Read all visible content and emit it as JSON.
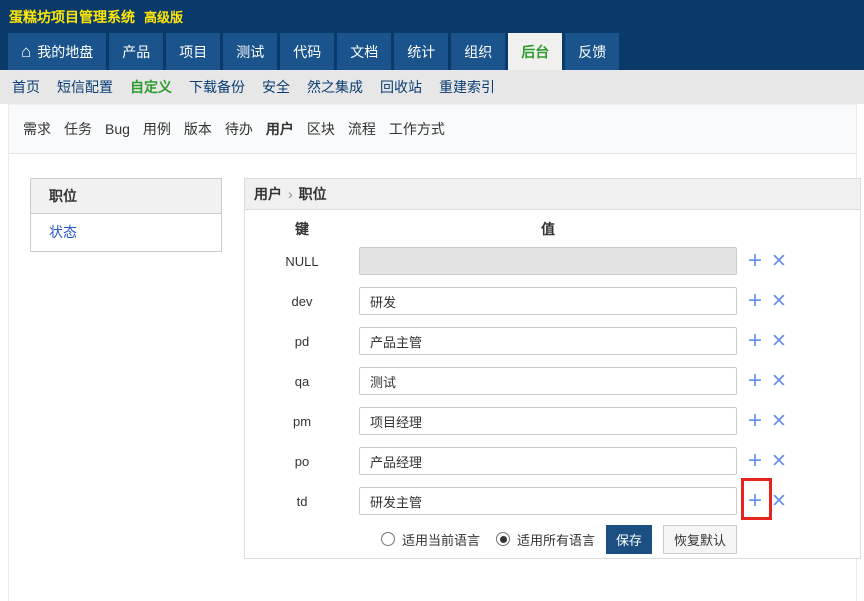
{
  "header": {
    "title": "蛋糕坊项目管理系统",
    "edition": "高级版"
  },
  "main_nav": {
    "items": [
      {
        "label": "我的地盘",
        "icon": "home",
        "active": false
      },
      {
        "label": "产品",
        "active": false
      },
      {
        "label": "项目",
        "active": false
      },
      {
        "label": "测试",
        "active": false
      },
      {
        "label": "代码",
        "active": false
      },
      {
        "label": "文档",
        "active": false
      },
      {
        "label": "统计",
        "active": false
      },
      {
        "label": "组织",
        "active": false
      },
      {
        "label": "后台",
        "active": true
      },
      {
        "label": "反馈",
        "active": false
      }
    ]
  },
  "sub_nav": {
    "items": [
      {
        "label": "首页",
        "active": false
      },
      {
        "label": "短信配置",
        "active": false
      },
      {
        "label": "自定义",
        "active": true
      },
      {
        "label": "下载备份",
        "active": false
      },
      {
        "label": "安全",
        "active": false
      },
      {
        "label": "然之集成",
        "active": false
      },
      {
        "label": "回收站",
        "active": false
      },
      {
        "label": "重建索引",
        "active": false
      }
    ]
  },
  "module_nav": {
    "items": [
      {
        "label": "需求",
        "active": false
      },
      {
        "label": "任务",
        "active": false
      },
      {
        "label": "Bug",
        "active": false
      },
      {
        "label": "用例",
        "active": false
      },
      {
        "label": "版本",
        "active": false
      },
      {
        "label": "待办",
        "active": false
      },
      {
        "label": "用户",
        "active": true
      },
      {
        "label": "区块",
        "active": false
      },
      {
        "label": "流程",
        "active": false
      },
      {
        "label": "工作方式",
        "active": false
      }
    ]
  },
  "sidebar": {
    "header": "职位",
    "items": [
      {
        "label": "状态"
      }
    ]
  },
  "panel": {
    "breadcrumb": {
      "parent": "用户",
      "separator": "›",
      "current": "职位"
    },
    "table": {
      "key_header": "键",
      "value_header": "值",
      "rows": [
        {
          "key": "NULL",
          "value": "",
          "disabled": true
        },
        {
          "key": "dev",
          "value": "研发"
        },
        {
          "key": "pd",
          "value": "产品主管"
        },
        {
          "key": "qa",
          "value": "测试"
        },
        {
          "key": "pm",
          "value": "项目经理"
        },
        {
          "key": "po",
          "value": "产品经理"
        },
        {
          "key": "td",
          "value": "研发主管",
          "highlighted": true
        }
      ]
    },
    "actions": {
      "radio_current_label": "适用当前语言",
      "radio_all_label": "适用所有语言",
      "selected": "all",
      "save_label": "保存",
      "reset_label": "恢复默认"
    }
  },
  "icons": {
    "home": "⌂",
    "add": "+",
    "remove": "✕"
  },
  "colors": {
    "topbar_navy": "#093a69",
    "tab_blue": "#1b548c",
    "active_tab_bg": "#f0f0ee",
    "accent_green": "#2e9b2e",
    "link_blue": "#2b54c8",
    "row_icon_blue": "#6b93e8",
    "save_button_blue": "#1b4e81",
    "annotation_red": "#e7231d"
  }
}
